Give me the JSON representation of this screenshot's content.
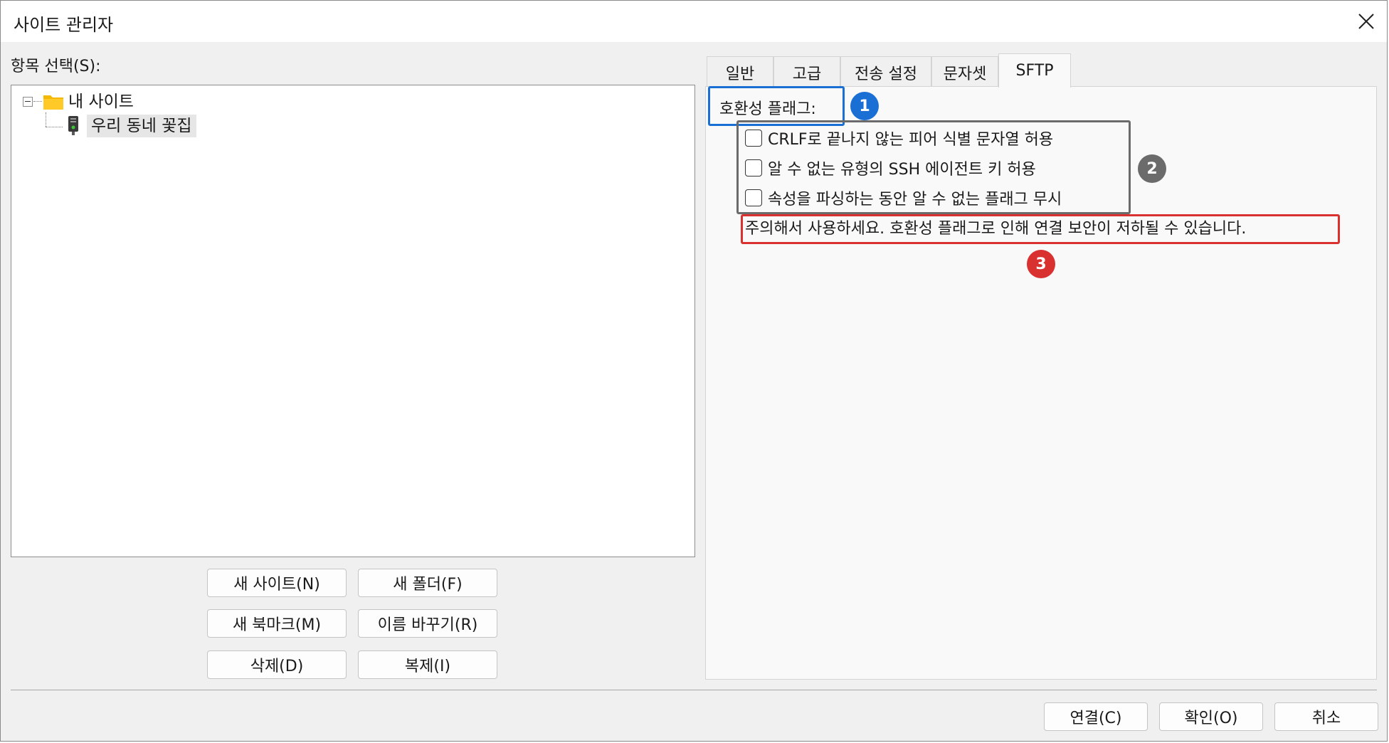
{
  "window": {
    "title": "사이트 관리자"
  },
  "left": {
    "section_label": "항목 선택(S):",
    "tree": [
      {
        "label": "내 사이트",
        "icon": "folder-icon"
      },
      {
        "label": "우리 동네 꽃집",
        "icon": "server-icon",
        "selected": true
      }
    ],
    "buttons": {
      "new_site": "새 사이트(N)",
      "new_folder": "새 폴더(F)",
      "new_bookmark": "새 북마크(M)",
      "rename": "이름 바꾸기(R)",
      "delete": "삭제(D)",
      "duplicate": "복제(I)"
    }
  },
  "tabs": [
    {
      "label": "일반"
    },
    {
      "label": "고급"
    },
    {
      "label": "전송 설정"
    },
    {
      "label": "문자셋"
    },
    {
      "label": "SFTP",
      "active": true
    }
  ],
  "sftp": {
    "compat_label": "호환성 플래그:",
    "checkboxes": [
      {
        "label": "CRLF로 끝나지 않는 피어 식별 문자열 허용",
        "checked": false
      },
      {
        "label": "알 수 없는 유형의 SSH 에이전트 키 허용",
        "checked": false
      },
      {
        "label": "속성을 파싱하는 동안 알 수 없는 플래그 무시",
        "checked": false
      }
    ],
    "warning": "주의해서 사용하세요. 호환성 플래그로 인해 연결 보안이 저하될 수 있습니다."
  },
  "annotations": [
    {
      "number": "1",
      "color": "#1a6fd4"
    },
    {
      "number": "2",
      "color": "#6b6b6b"
    },
    {
      "number": "3",
      "color": "#d93030"
    }
  ],
  "footer": {
    "connect": "연결(C)",
    "ok": "확인(O)",
    "cancel": "취소"
  },
  "colors": {
    "folder": "#f5b800",
    "annotation_blue": "#1a6fd4",
    "annotation_gray": "#6b6b6b",
    "annotation_red": "#d93030"
  }
}
